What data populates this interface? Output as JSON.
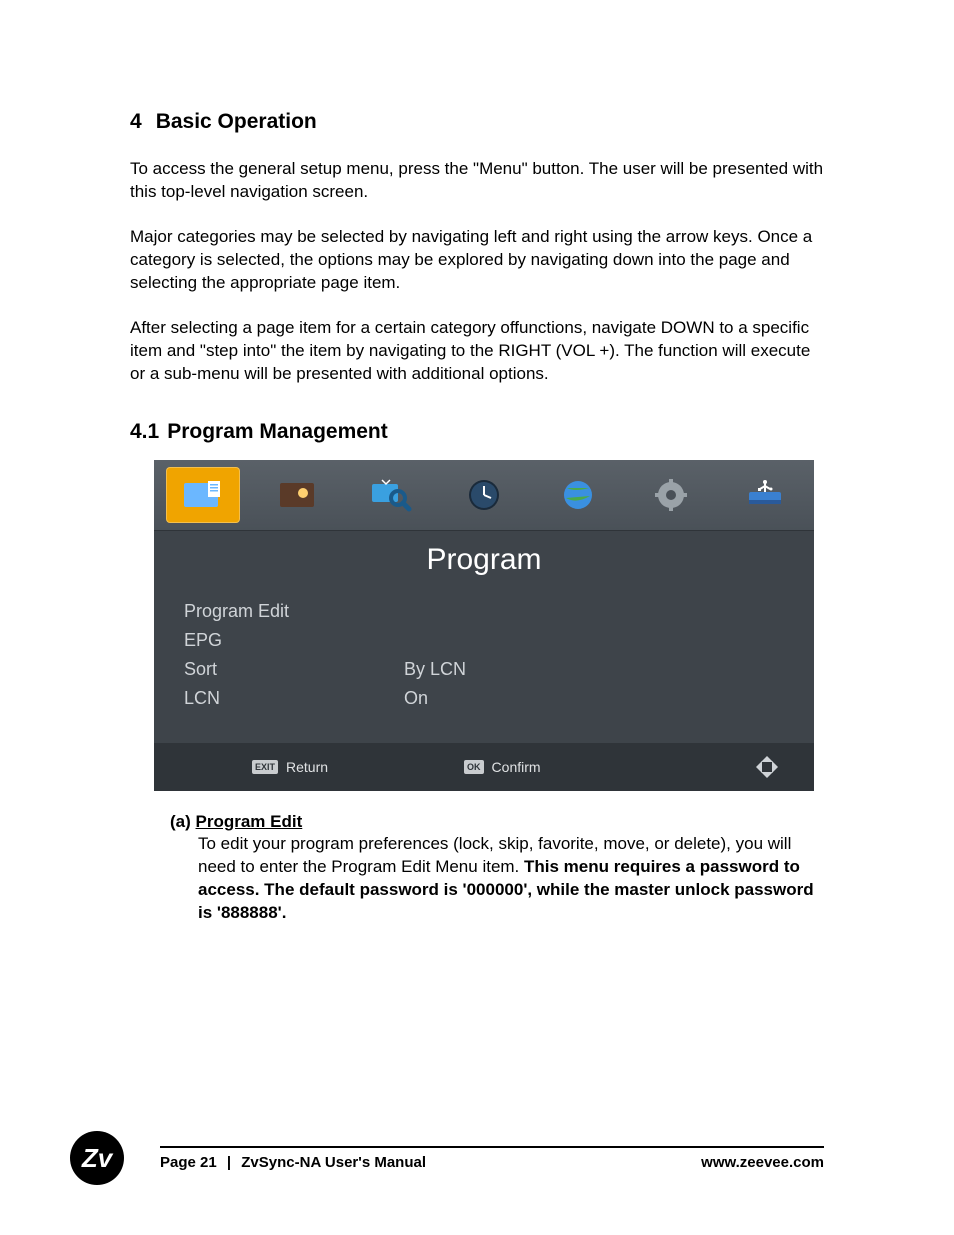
{
  "section": {
    "number": "4",
    "title": "Basic Operation"
  },
  "paragraphs": {
    "p1": "To access the general setup menu, press the \"Menu\" button.  The user will be presented with this top-level navigation screen.",
    "p2": "Major categories may be selected by navigating left and right using the arrow keys.  Once a category is selected, the options may be explored by navigating down into the page and selecting the appropriate page item.",
    "p3": "After selecting a page item for a certain category offunctions, navigate DOWN to a specific item and \"step into\" the item by navigating to the RIGHT (VOL +). The function will execute or a sub-menu will be presented with additional options."
  },
  "subsection": {
    "number": "4.1",
    "title": "Program Management"
  },
  "tvui": {
    "title": "Program",
    "tabs": [
      "program",
      "picture",
      "search",
      "time",
      "network",
      "settings",
      "usb"
    ],
    "rows": [
      {
        "label": "Program Edit",
        "value": ""
      },
      {
        "label": "EPG",
        "value": ""
      },
      {
        "label": "Sort",
        "value": "By LCN"
      },
      {
        "label": "LCN",
        "value": "On"
      }
    ],
    "footer": {
      "exit_badge": "EXIT",
      "exit_label": "Return",
      "ok_badge": "OK",
      "ok_label": "Confirm"
    }
  },
  "subitem": {
    "marker": "(a)",
    "title": "Program Edit",
    "lead": "To edit your program preferences (lock, skip, favorite, move, or delete), you will need to enter the Program Edit Menu item.  ",
    "bold": "This menu requires a password to access.  The default password is '000000', while the master unlock password is '888888'."
  },
  "footer": {
    "logo": "Zv",
    "page_label": "Page 21",
    "sep": "|",
    "manual": "ZvSync-NA User's Manual",
    "url": "www.zeevee.com"
  }
}
